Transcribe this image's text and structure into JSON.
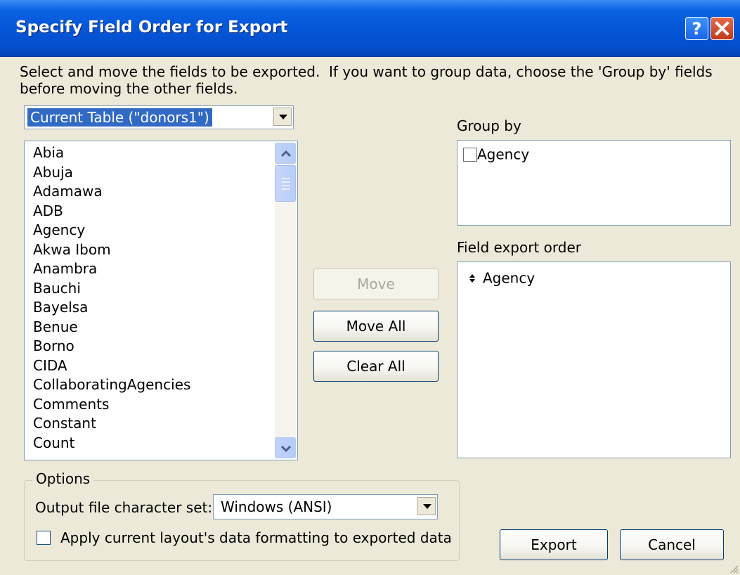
{
  "window": {
    "title": "Specify Field Order for Export"
  },
  "instructions": "Select and move the fields to be exported.  If you want to group data, choose the 'Group by' fields\nbefore moving the other fields.",
  "table_selector": {
    "value": "Current Table (\"donors1\")"
  },
  "field_list": {
    "items": [
      "Abia",
      "Abuja",
      "Adamawa",
      "ADB",
      "Agency",
      "Akwa Ibom",
      "Anambra",
      "Bauchi",
      "Bayelsa",
      "Benue",
      "Borno",
      "CIDA",
      "CollaboratingAgencies",
      "Comments",
      "Constant",
      "Count"
    ]
  },
  "buttons": {
    "move": "Move",
    "move_all": "Move All",
    "clear_all": "Clear All",
    "export": "Export",
    "cancel": "Cancel"
  },
  "group_by": {
    "label": "Group by",
    "items": [
      {
        "label": "Agency",
        "checked": false
      }
    ]
  },
  "field_export_order": {
    "label": "Field export order",
    "items": [
      "Agency"
    ]
  },
  "options": {
    "legend": "Options",
    "charset_label": "Output file character set:",
    "charset_value": "Windows (ANSI)",
    "apply_formatting_label": "Apply current layout's data formatting to exported data",
    "apply_formatting_checked": false
  },
  "icons": [
    "help-icon",
    "close-icon",
    "dropdown-arrow-icon",
    "scroll-up-icon",
    "scroll-down-icon",
    "move-handle-icon",
    "resize-grip-icon"
  ],
  "colors": {
    "titlebar": "#0556d8",
    "dialog_bg": "#ece9d8",
    "selection": "#316ac5",
    "close_button": "#c1381a"
  }
}
